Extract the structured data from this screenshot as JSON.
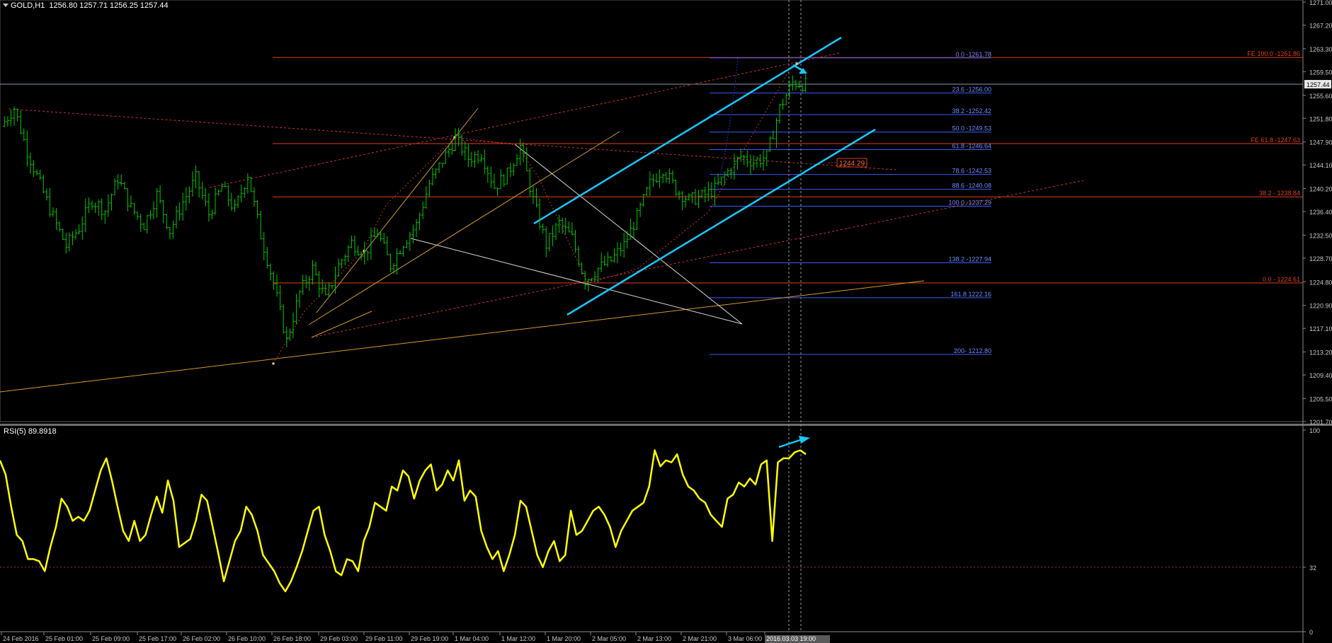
{
  "header": {
    "symbol": "GOLD,H1",
    "ohlc": "1256.80 1257.71 1256.25 1257.44",
    "rsi_label": "RSI(5) 89.8918"
  },
  "colors": {
    "background": "#000000",
    "bull_candle": "#00c800",
    "rsi_line": "#ffff00",
    "fib_blue": "#3a5cff",
    "horizontal_red": "#e0401a",
    "channel_cyan": "#19c8ff",
    "fan_orange": "#d39a2a",
    "triangle_white": "#d8d8d8",
    "axis_text": "#c8c8c8"
  },
  "chart_data": [
    {
      "type": "candlestick",
      "title": "GOLD,H1",
      "price_axis_ticks": [
        "1271.00",
        "1267.20",
        "1263.30",
        "1259.50",
        "1255.60",
        "1251.80",
        "1247.90",
        "1244.10",
        "1240.20",
        "1236.40",
        "1232.50",
        "1228.70",
        "1224.80",
        "1220.90",
        "1217.10",
        "1213.20",
        "1209.40",
        "1205.50",
        "1201.70"
      ],
      "ylim": [
        1201.7,
        1271.0
      ],
      "time_axis_ticks": [
        "24 Feb 2016",
        "25 Feb 01:00",
        "25 Feb 09:00",
        "25 Feb 17:00",
        "26 Feb 02:00",
        "26 Feb 10:00",
        "26 Feb 18:00",
        "29 Feb 03:00",
        "29 Feb 11:00",
        "29 Feb 19:00",
        "1 Mar 04:00",
        "1 Mar 12:00",
        "1 Mar 20:00",
        "2 Mar 05:00",
        "2 Mar 13:00",
        "2 Mar 21:00",
        "3 Mar 06:00",
        "2016.03.03 19:00"
      ],
      "current_price": "1257.44",
      "price_path": [
        1250.5,
        1253.5,
        1246.4,
        1240.9,
        1235.5,
        1230.7,
        1233.7,
        1238.3,
        1236.6,
        1241.9,
        1237.0,
        1234.2,
        1239.2,
        1233.2,
        1238.0,
        1241.9,
        1236.0,
        1240.5,
        1236.6,
        1242.6,
        1232.5,
        1224.5,
        1215.0,
        1223.0,
        1227.0,
        1221.9,
        1227.5,
        1231.3,
        1229.5,
        1233.0,
        1227.5,
        1231.3,
        1234.2,
        1241.0,
        1244.8,
        1248.5,
        1245.2,
        1246.0,
        1240.5,
        1242.5,
        1247.2,
        1238.3,
        1230.9,
        1234.5,
        1232.0,
        1225.0,
        1227.0,
        1228.3,
        1230.9,
        1235.5,
        1241.0,
        1243.5,
        1240.1,
        1238.3,
        1238.9,
        1240.1,
        1243.0,
        1245.5,
        1244.6,
        1245.5,
        1253.5,
        1257.7,
        1257.4
      ],
      "fibonacci_retracement": [
        {
          "label": "0.0 -1261.78",
          "price": 1261.78
        },
        {
          "label": "23.6 -1256.00",
          "price": 1256.0
        },
        {
          "label": "38.2 -1252.42",
          "price": 1252.42
        },
        {
          "label": "50.0 -1249.53",
          "price": 1249.53
        },
        {
          "label": "61.8 -1246.64",
          "price": 1246.64
        },
        {
          "label": "78.6 -1242.53",
          "price": 1242.53
        },
        {
          "label": "88.6 -1240.08",
          "price": 1240.08
        },
        {
          "label": "100.0 -1237.29",
          "price": 1237.29
        },
        {
          "label": "138.2 -1227.94",
          "price": 1227.94
        },
        {
          "label": "161.8 1222.16",
          "price": 1222.16
        },
        {
          "label": "200- 1212.80",
          "price": 1212.8
        }
      ],
      "horizontal_levels": [
        {
          "label": "FE 100.0 -1261.86",
          "price": 1261.86
        },
        {
          "label": "FE 61.8 -1247.63",
          "price": 1247.63
        },
        {
          "label": "38.2 - 1238.84",
          "price": 1238.84
        },
        {
          "label": "0.0 - 1224.61",
          "price": 1224.61
        }
      ],
      "price_tag": "1244.29"
    },
    {
      "type": "line",
      "title": "RSI(5) 89.8918",
      "ylim": [
        0,
        100
      ],
      "level_ticks": [
        "100",
        "32",
        "0"
      ],
      "level_line": 32,
      "values": [
        85,
        78,
        62,
        48,
        45,
        36,
        36,
        35,
        30,
        42,
        52,
        66,
        62,
        55,
        57,
        55,
        60,
        70,
        80,
        86,
        75,
        62,
        50,
        45,
        55,
        45,
        48,
        58,
        67,
        59,
        75,
        65,
        42,
        44,
        46,
        55,
        68,
        65,
        52,
        39,
        25,
        35,
        45,
        50,
        62,
        58,
        50,
        38,
        34,
        30,
        24,
        20,
        25,
        32,
        40,
        50,
        60,
        62,
        48,
        40,
        30,
        28,
        36,
        35,
        30,
        45,
        52,
        64,
        62,
        60,
        72,
        70,
        80,
        77,
        66,
        75,
        80,
        83,
        70,
        73,
        80,
        75,
        85,
        65,
        70,
        67,
        50,
        42,
        36,
        40,
        30,
        38,
        48,
        65,
        62,
        50,
        38,
        32,
        40,
        45,
        35,
        38,
        60,
        48,
        50,
        55,
        60,
        62,
        58,
        52,
        42,
        50,
        55,
        60,
        62,
        64,
        72,
        90,
        82,
        85,
        84,
        88,
        78,
        72,
        70,
        66,
        64,
        58,
        55,
        52,
        66,
        68,
        74,
        72,
        76,
        73,
        83,
        85,
        45,
        84,
        86,
        86,
        89,
        90,
        88
      ]
    }
  ]
}
